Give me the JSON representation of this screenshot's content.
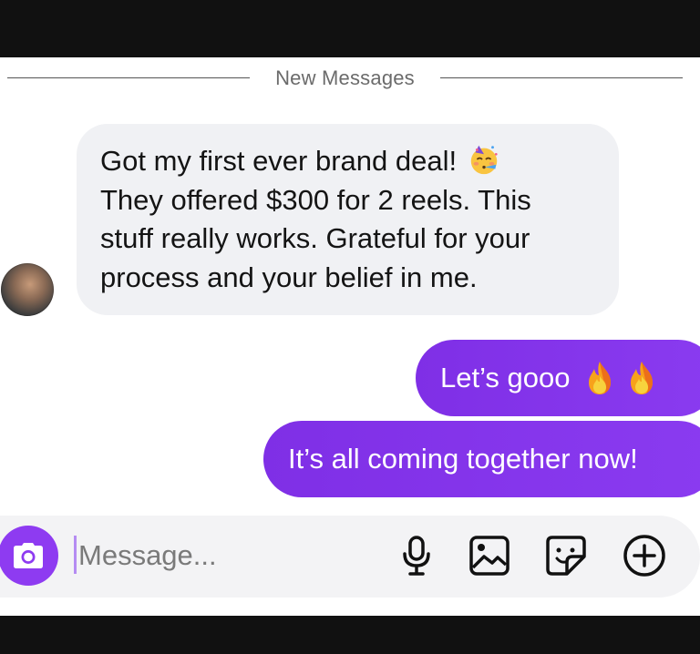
{
  "divider": {
    "label": "New Messages"
  },
  "incoming": {
    "lines": [
      "Got my first ever brand deal!",
      "They offered $300 for 2 reels. This",
      "stuff really works. Grateful for your",
      "process and your belief in me."
    ],
    "emoji": "partying-face-emoji"
  },
  "outgoing": [
    {
      "text": "Let’s gooo",
      "emoji": "fire-emoji",
      "emoji_count": 2
    },
    {
      "text": "It’s all coming together now!"
    }
  ],
  "composer": {
    "placeholder": "Message...",
    "tools": [
      "microphone-icon",
      "image-icon",
      "sticker-icon",
      "plus-icon"
    ]
  },
  "colors": {
    "accent": "#8a3bf0",
    "incoming_bubble": "#f0f1f4",
    "background": "#ffffff",
    "bars": "#111111"
  }
}
